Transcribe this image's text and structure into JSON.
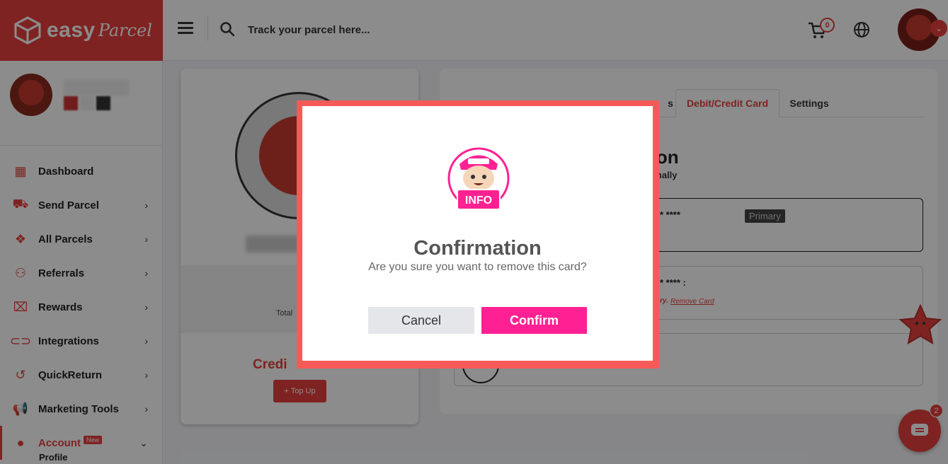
{
  "header": {
    "logo_text": "easy",
    "logo_script": "Parcel",
    "search_placeholder": "Track your parcel here...",
    "cart_count": "0"
  },
  "sidebar": {
    "items": [
      {
        "label": "Dashboard",
        "icon": "dashboard-icon"
      },
      {
        "label": "Send Parcel",
        "icon": "truck-icon"
      },
      {
        "label": "All Parcels",
        "icon": "boxes-icon"
      },
      {
        "label": "Referrals",
        "icon": "users-plus-icon"
      },
      {
        "label": "Rewards",
        "icon": "gift-icon"
      },
      {
        "label": "Integrations",
        "icon": "link-icon"
      },
      {
        "label": "QuickReturn",
        "icon": "return-icon"
      },
      {
        "label": "Marketing Tools",
        "icon": "megaphone-icon"
      },
      {
        "label": "Account",
        "icon": "user-icon",
        "badge": "New"
      }
    ],
    "sub_item": "Profile"
  },
  "left_card": {
    "total_label": "Total",
    "credit_label": "Credi",
    "topup_label": "+ Top Up"
  },
  "right_card": {
    "tabs": [
      "s",
      "Debit/Credit Card",
      "Settings"
    ],
    "heading_partial": "tion",
    "subheading_partial": "tionally",
    "card1_masked": "* ****",
    "card1_badge": "Primary",
    "card2_masked": "* **** :",
    "card2_suffix": "ry.",
    "remove_link": "Remove Card"
  },
  "modal": {
    "mascot_label": "INFO",
    "title": "Confirmation",
    "message": "Are you sure you want to remove this card?",
    "cancel": "Cancel",
    "confirm": "Confirm"
  },
  "chat": {
    "badge": "2"
  },
  "colors": {
    "brand_red": "#e6413e",
    "confirm_pink": "#ff2193",
    "modal_frame": "#f65a58"
  }
}
